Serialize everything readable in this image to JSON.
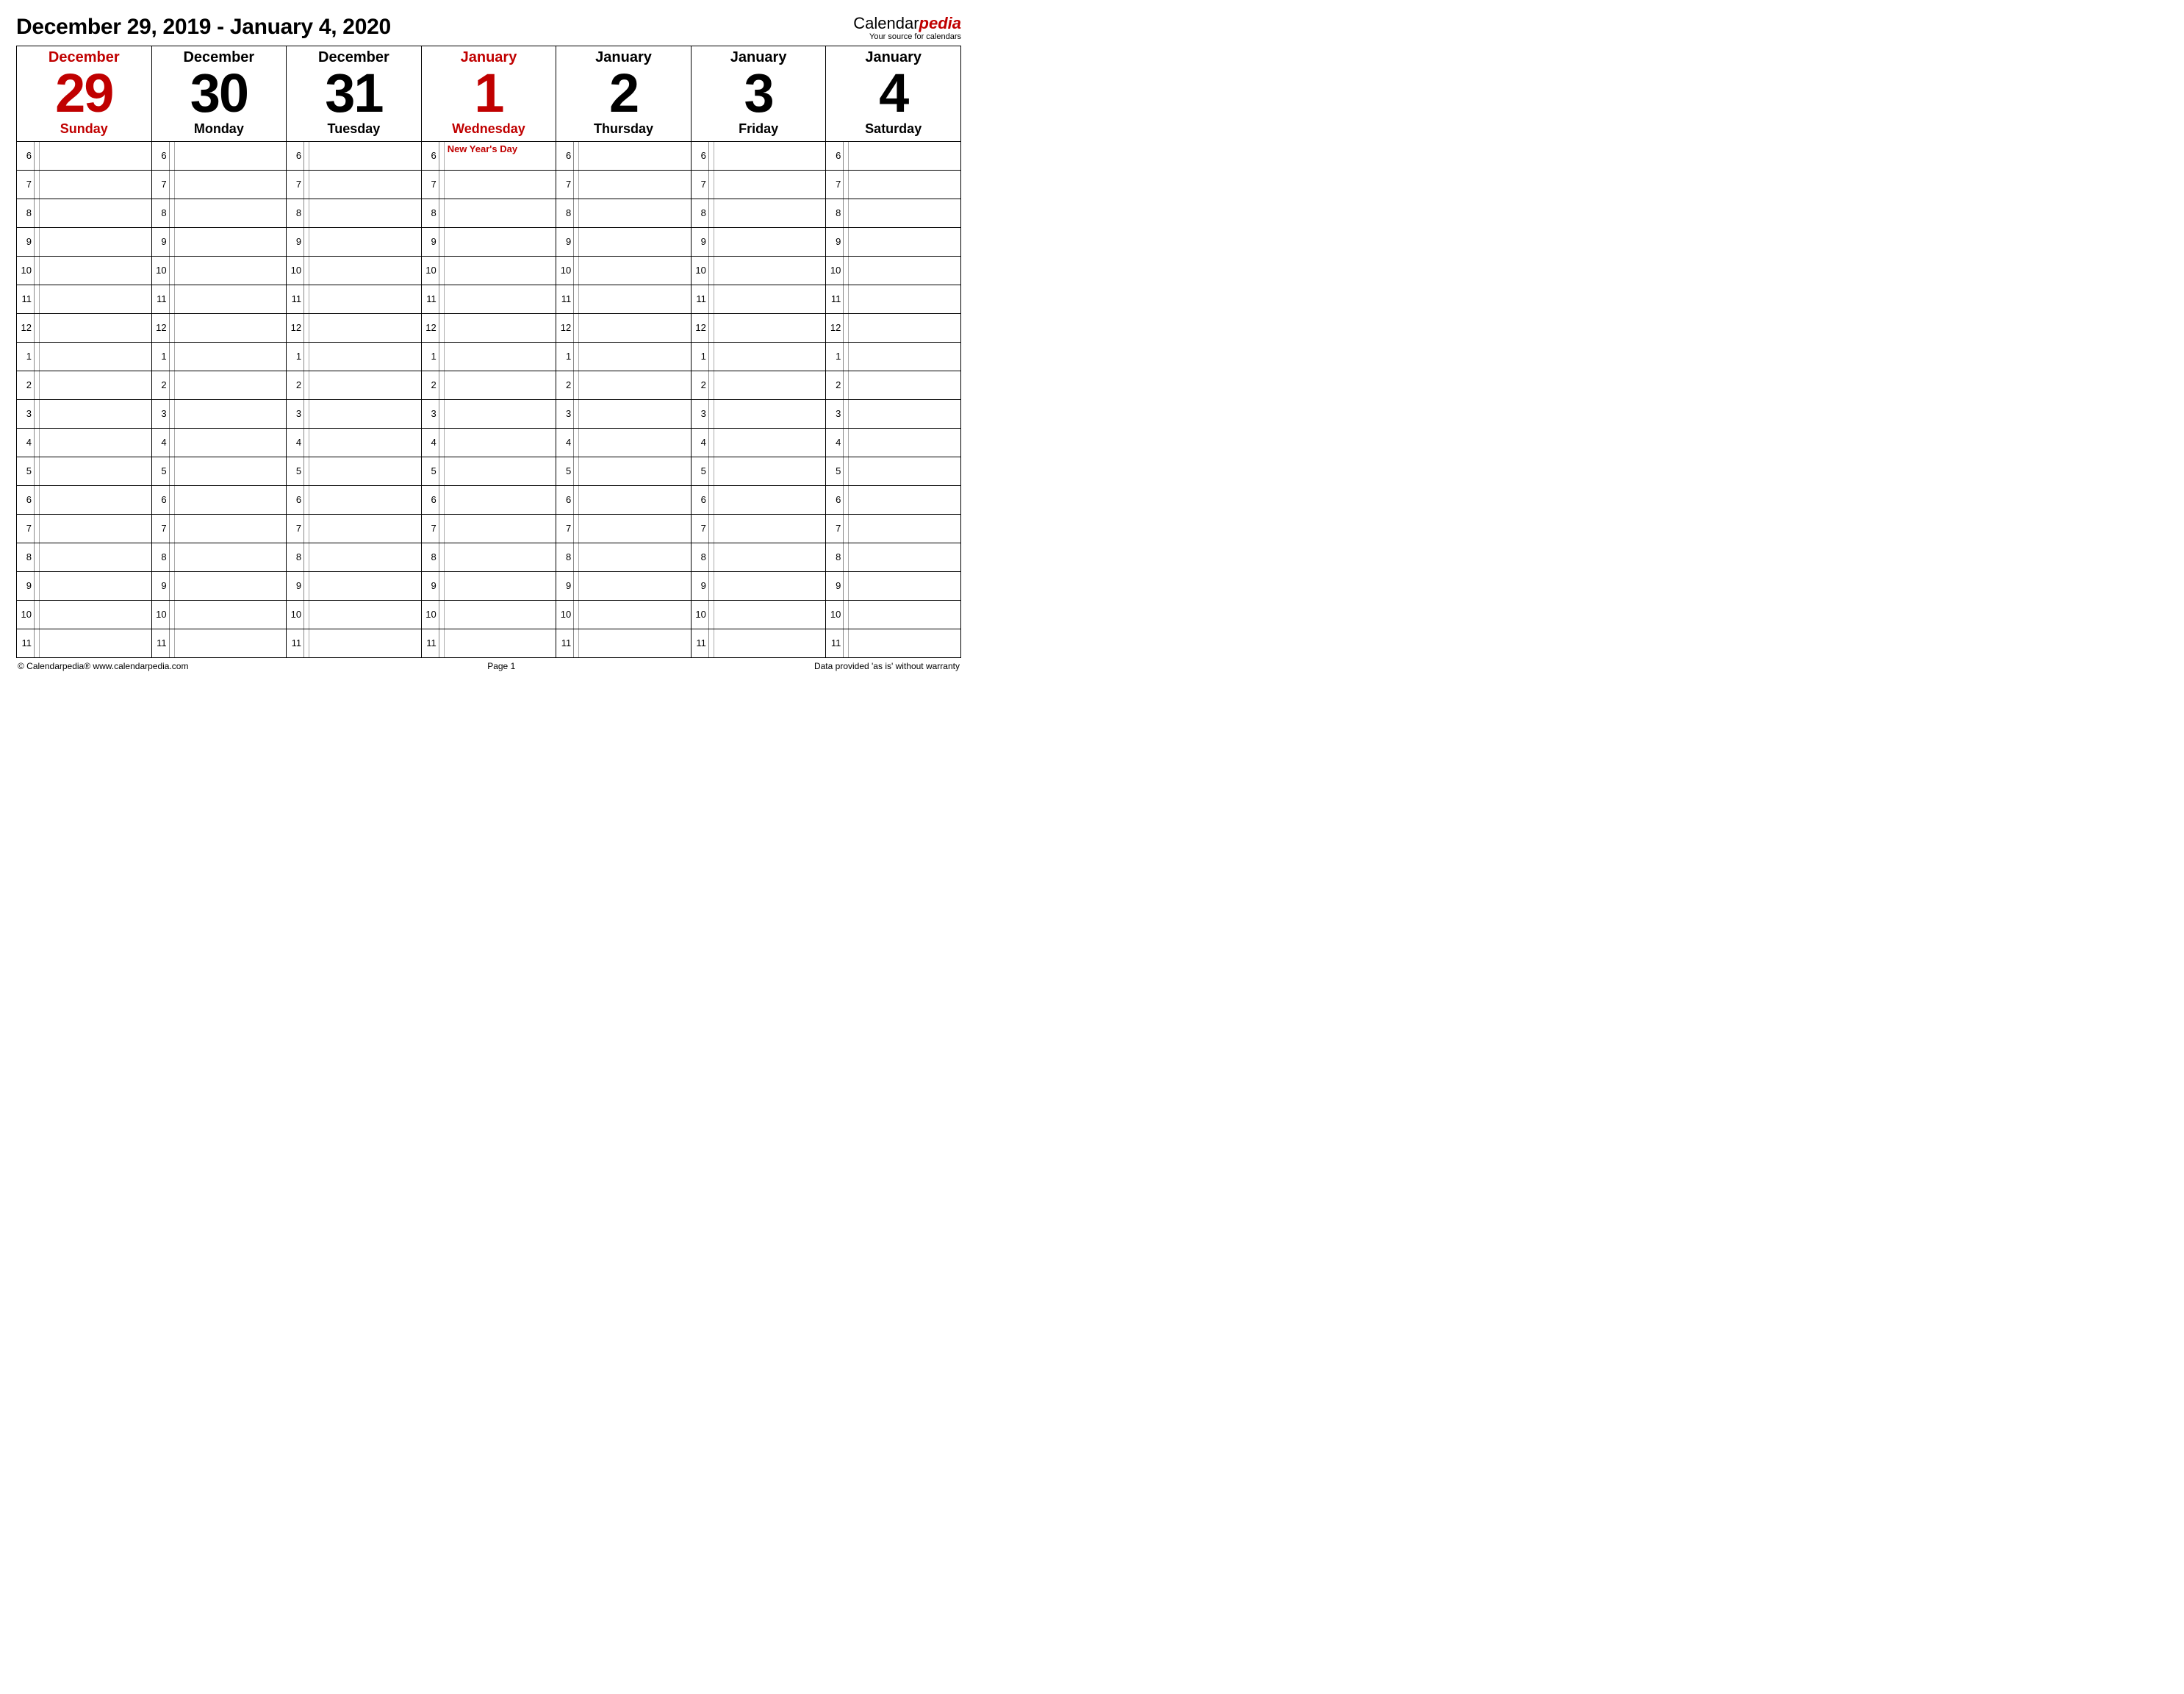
{
  "header": {
    "title": "December 29, 2019 - January 4, 2020",
    "brand_prefix": "Calendar",
    "brand_suffix": "pedia",
    "brand_tagline": "Your source for calendars"
  },
  "days": [
    {
      "month": "December",
      "num": "29",
      "dow": "Sunday",
      "red": true
    },
    {
      "month": "December",
      "num": "30",
      "dow": "Monday",
      "red": false
    },
    {
      "month": "December",
      "num": "31",
      "dow": "Tuesday",
      "red": false
    },
    {
      "month": "January",
      "num": "1",
      "dow": "Wednesday",
      "red": true
    },
    {
      "month": "January",
      "num": "2",
      "dow": "Thursday",
      "red": false
    },
    {
      "month": "January",
      "num": "3",
      "dow": "Friday",
      "red": false
    },
    {
      "month": "January",
      "num": "4",
      "dow": "Saturday",
      "red": false
    }
  ],
  "hours": [
    "6",
    "7",
    "8",
    "9",
    "10",
    "11",
    "12",
    "1",
    "2",
    "3",
    "4",
    "5",
    "6",
    "7",
    "8",
    "9",
    "10",
    "11"
  ],
  "events": {
    "3": {
      "0": "New Year's Day"
    }
  },
  "footer": {
    "left": "© Calendarpedia®   www.calendarpedia.com",
    "center": "Page 1",
    "right": "Data provided 'as is' without warranty"
  }
}
